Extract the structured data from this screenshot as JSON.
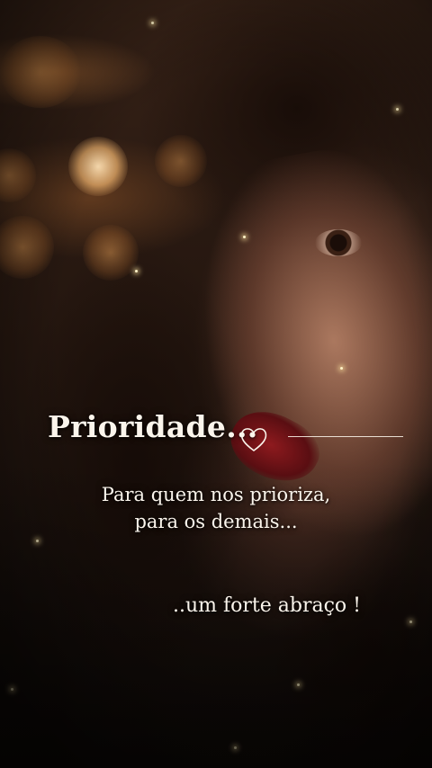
{
  "quote": {
    "title": "Prioridade...",
    "line1": "Para quem nos prioriza,",
    "line2": "para os demais...",
    "closing": "..um forte abraço !"
  },
  "icons": {
    "heart": "heart-outline-icon"
  },
  "colors": {
    "text": "#fbf5ec",
    "accent_lips": "#8e1a1e",
    "bokeh": "#f0b46e"
  }
}
